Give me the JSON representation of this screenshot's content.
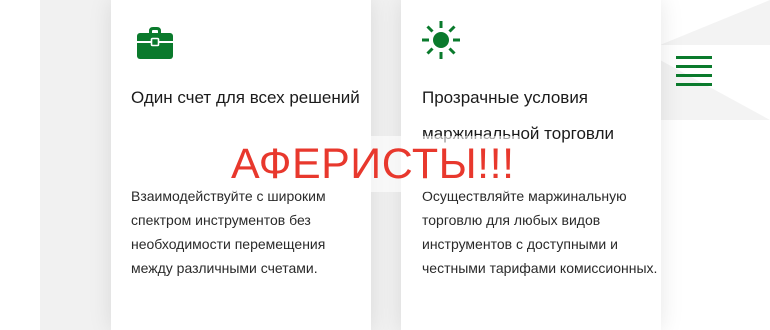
{
  "colors": {
    "accent_green": "#0a7a2c",
    "watermark_red": "#e8382d",
    "text": "#1b1b1b"
  },
  "cards": [
    {
      "icon": "briefcase-icon",
      "title": "Один счет для всех решений",
      "description": "Взаимодействуйте с широким спектром инструментов без необходимости перемещения между различными счетами."
    },
    {
      "icon": "sun-icon",
      "title": "Прозрачные условия маржинальной торговли",
      "description": "Осуществляйте маржинальную торговлю для любых видов инструментов с доступными и честными тарифами комиссионных."
    }
  ],
  "menu": {
    "icon": "hamburger-menu-icon"
  },
  "watermark": {
    "text": "АФЕРИСТЫ!!!"
  }
}
